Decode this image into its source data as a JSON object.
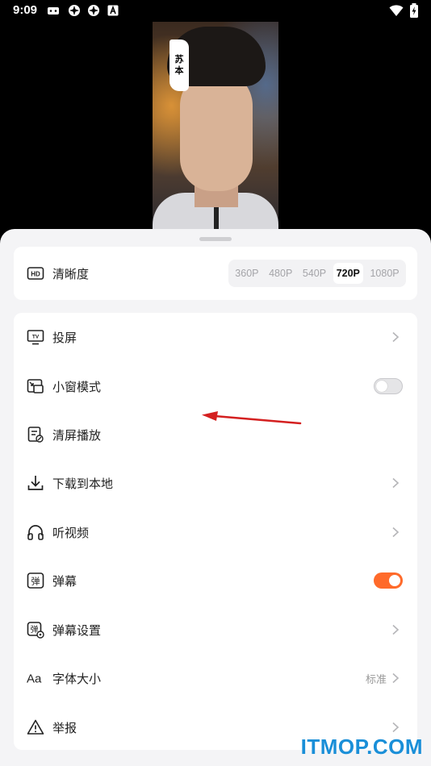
{
  "status_bar": {
    "time": "9:09",
    "icons": [
      "game-controller-icon",
      "settings-gear-icon",
      "settings-gear-icon",
      "a-letter-icon"
    ],
    "right_icons": [
      "wifi-icon",
      "battery-charging-icon"
    ]
  },
  "video": {
    "overlay_tag": [
      "苏",
      "本"
    ]
  },
  "quality": {
    "label": "清晰度",
    "icon": "hd-icon",
    "options": [
      "360P",
      "480P",
      "540P",
      "720P",
      "1080P"
    ],
    "selected": "720P"
  },
  "menu": {
    "items": [
      {
        "icon": "tv-cast-icon",
        "label": "投屏",
        "control": "chevron"
      },
      {
        "icon": "pip-window-icon",
        "label": "小窗模式",
        "control": "toggle",
        "on": false
      },
      {
        "icon": "clear-screen-icon",
        "label": "清屏播放",
        "control": "none"
      },
      {
        "icon": "download-icon",
        "label": "下载到本地",
        "control": "chevron"
      },
      {
        "icon": "headphones-icon",
        "label": "听视频",
        "control": "chevron"
      },
      {
        "icon": "danmaku-icon",
        "label": "弹幕",
        "control": "toggle",
        "on": true
      },
      {
        "icon": "danmaku-settings-icon",
        "label": "弹幕设置",
        "control": "chevron"
      },
      {
        "icon": "font-size-icon",
        "label": "字体大小",
        "control": "chevron",
        "value": "标准"
      },
      {
        "icon": "warning-icon",
        "label": "举报",
        "control": "chevron"
      }
    ]
  },
  "watermark": "ITMOP.COM",
  "colors": {
    "accent": "#ff6a2a",
    "watermark": "#1a8fd8",
    "annotation_arrow": "#d42020"
  }
}
